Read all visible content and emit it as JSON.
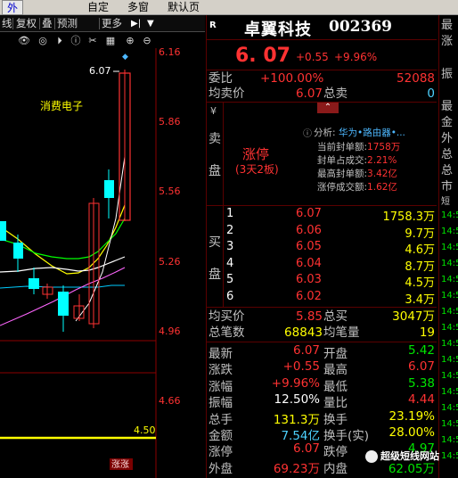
{
  "menubar": {
    "left_tab": "外汇",
    "item1": "自定",
    "item2": "多窗",
    "item3": "默认页"
  },
  "toolbar": {
    "items": [
      "线",
      "复权",
      "叠",
      "预测",
      "更多"
    ],
    "play_glyph": "▶|",
    "dropdown_glyph": "▼"
  },
  "chart": {
    "price_ticks": [
      "6.16",
      "5.86",
      "5.56",
      "5.26",
      "4.96",
      "4.66"
    ],
    "high_label": "6.07",
    "concept_label": "消费电子",
    "volume_label": "4.50",
    "limit_badge": "涨涨",
    "colors": {
      "up": "#ff3232",
      "down": "#00ffff",
      "ma1": "#ffffff",
      "ma2": "#ffff00",
      "ma3": "#ff00ff",
      "ma4": "#00ff00"
    }
  },
  "stock": {
    "name": "卓翼科技",
    "code": "002369",
    "r_tag": "R",
    "price": "6. 07",
    "change": "+0.55",
    "change_pct": "+9.96%"
  },
  "summary": {
    "weibi_label": "委比",
    "weibi_pct": "+100.00%",
    "weibi_val": "52088",
    "sell_avg_label": "均卖价",
    "sell_avg_val": "6.07",
    "total_sell_label": "总卖",
    "total_sell_val": "0"
  },
  "sell_side": {
    "label_chars": [
      "¥",
      "卖",
      "盘"
    ],
    "limit_up": "涨停",
    "streak": "(3天2板)",
    "analysis_label": "分析:",
    "analysis_text": "华为•路由器•...",
    "details": [
      {
        "label": "当前封单额:",
        "value": "1758万"
      },
      {
        "label": "封单占成交:",
        "value": "2.21%"
      },
      {
        "label": "最高封单额:",
        "value": "3.42亿"
      },
      {
        "label": "涨停成交额:",
        "value": "1.62亿"
      }
    ]
  },
  "buy_side": {
    "label_chars": [
      "买",
      "盘"
    ],
    "levels": [
      {
        "n": "1",
        "price": "6.07",
        "vol": "1758.3万"
      },
      {
        "n": "2",
        "price": "6.06",
        "vol": "9.7万"
      },
      {
        "n": "3",
        "price": "6.05",
        "vol": "4.6万"
      },
      {
        "n": "4",
        "price": "6.04",
        "vol": "8.7万"
      },
      {
        "n": "5",
        "price": "6.03",
        "vol": "4.5万"
      },
      {
        "n": "6",
        "price": "6.02",
        "vol": "3.4万"
      }
    ]
  },
  "buy_summary": {
    "buy_avg_label": "均买价",
    "buy_avg_val": "5.85",
    "total_buy_label": "总买",
    "total_buy_val": "3047万",
    "count_label": "总笔数",
    "count_val": "68843",
    "per_label": "均笔量",
    "per_val": "19"
  },
  "stats": [
    {
      "l1": "最新",
      "v1": "6.07",
      "c1": "red",
      "l2": "开盘",
      "v2": "5.42",
      "c2": "grn"
    },
    {
      "l1": "涨跌",
      "v1": "+0.55",
      "c1": "red",
      "l2": "最高",
      "v2": "6.07",
      "c2": "red"
    },
    {
      "l1": "涨幅",
      "v1": "+9.96%",
      "c1": "red",
      "l2": "最低",
      "v2": "5.38",
      "c2": "grn"
    },
    {
      "l1": "振幅",
      "v1": "12.50%",
      "c1": "wht",
      "l2": "量比",
      "v2": "4.44",
      "c2": "red"
    },
    {
      "l1": "总手",
      "v1": "131.3万",
      "c1": "wht",
      "l2": "换手",
      "v2": "23.19%",
      "c2": "wht"
    },
    {
      "l1": "金额",
      "v1": "7.54亿",
      "c1": "wht",
      "l2": "换手(实)",
      "v2": "28.00%",
      "c2": "wht"
    },
    {
      "l1": "涨停",
      "v1": "6.07",
      "c1": "red",
      "l2": "跌停",
      "v2": "4.97",
      "c2": "grn"
    },
    {
      "l1": "外盘",
      "v1": "69.23万",
      "c1": "red",
      "l2": "内盘",
      "v2": "62.05万",
      "c2": "grn"
    }
  ],
  "far_strip": {
    "labels": [
      "最",
      "涨",
      "振",
      "最",
      "金",
      "外",
      "总",
      "总",
      "市",
      "短"
    ],
    "times": [
      "14:5",
      "14:5",
      "14:5",
      "14:5",
      "14:5",
      "14:5",
      "14:5",
      "14:5",
      "14:5",
      "14:5",
      "14:5",
      "14:5",
      "14:5",
      "14:5",
      "14:5",
      "14:5"
    ]
  },
  "watermark": "超级短线网站"
}
